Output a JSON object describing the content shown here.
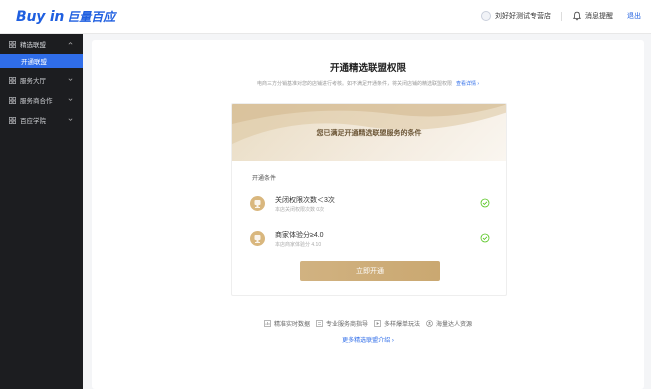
{
  "header": {
    "logo_en": "Buy in",
    "logo_cn": "巨量百应",
    "shop_name": "刘好好测试专营店",
    "messages": "消息提醒",
    "logout": "退出"
  },
  "sidebar": {
    "items": [
      {
        "label": "精选联盟",
        "expanded": true,
        "children": [
          {
            "label": "开通联盟",
            "active": true
          }
        ]
      },
      {
        "label": "服务大厅",
        "expanded": false
      },
      {
        "label": "服务商合作",
        "expanded": false
      },
      {
        "label": "百应学院",
        "expanded": false
      }
    ]
  },
  "main": {
    "title": "开通精选联盟权限",
    "subtitle": "电商三方分销基准对您的店铺进行考核。如不满足开通条件，将关闭店铺的精选联盟权限",
    "subtitle_link": "查看详情 ›",
    "banner_text": "您已满足开通精选联盟服务的条件",
    "conditions_label": "开通条件",
    "conditions": [
      {
        "name": "关闭权限次数＜3次",
        "detail": "本店关闭权限次数 0次"
      },
      {
        "name": "商家体验分≥4.0",
        "detail": "本店商家体验分 4.10"
      }
    ],
    "open_button": "立即开通",
    "features": [
      "精准实时数据",
      "专业服务商指导",
      "多样爆单玩法",
      "海量达人资源"
    ],
    "more_link": "更多精选联盟介绍 ›"
  },
  "colors": {
    "brand": "#1f5fe0",
    "sidebar_bg": "#1c1d20",
    "active": "#2f6de9",
    "gold": "#d1b281",
    "check": "#52c41a"
  },
  "icons": [
    "avatar-icon",
    "bell-icon",
    "grid-icon",
    "chevron-icon",
    "trophy-icon",
    "check-circle-icon",
    "feature-icon"
  ]
}
